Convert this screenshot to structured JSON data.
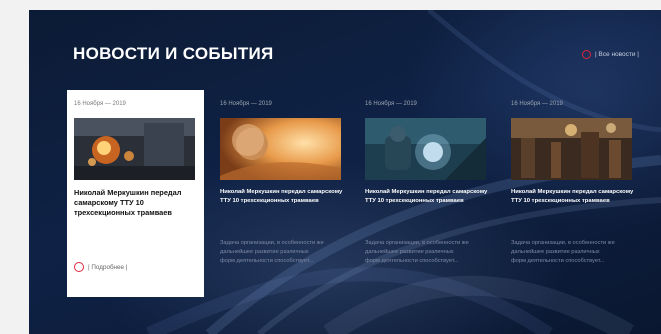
{
  "section": {
    "title": "НОВОСТИ И СОБЫТИЯ",
    "all_news_label": "| Все новости |"
  },
  "news": [
    {
      "date": "16 Ноября — 2019",
      "headline": "Николай Меркушкин передал самарскому ТТУ 10 трехсекционных трамваев",
      "more_label": "| Подробнее |",
      "image": "sparks-workshop"
    },
    {
      "date": "16 Ноября — 2019",
      "headline": "Николай Меркушкин передал самарскому ТТУ 10 трехсекционных трамваев",
      "excerpt": "Задача организации, в особенности же дальнейшее развитие различных форм деятельности способствует...",
      "image": "planet-space"
    },
    {
      "date": "16 Ноября — 2019",
      "headline": "Николай Меркушкин передал самарскому ТТУ 10 трехсекционных трамваев",
      "excerpt": "Задача организации, в особенности же дальнейшее развитие различных форм деятельности способствует...",
      "image": "welder-at-work"
    },
    {
      "date": "16 Ноября — 2019",
      "headline": "Николай Меркушкин передал самарскому ТТУ 10 трехсекционных трамваев",
      "excerpt": "Задача организации, в особенности же дальнейшее развитие различных форм деятельности способствует...",
      "image": "factory-hall"
    }
  ],
  "colors": {
    "accent": "#e0253a",
    "background": "#0f2246",
    "card": "#ffffff"
  }
}
